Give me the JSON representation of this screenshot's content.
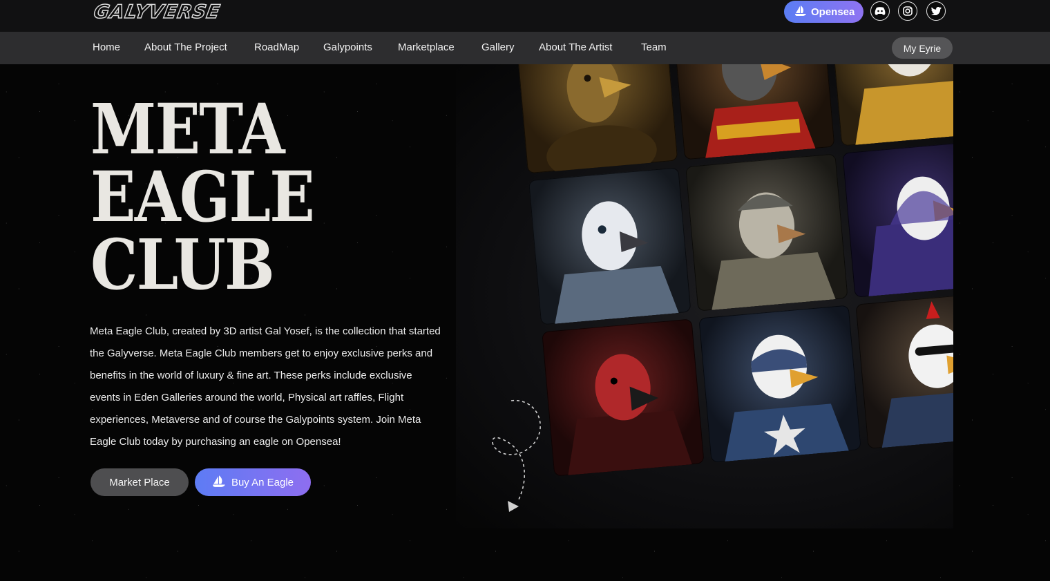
{
  "header": {
    "logo_text": "GALYVERSE",
    "opensea_label": "Opensea",
    "social_icons": [
      "discord-icon",
      "instagram-icon",
      "twitter-icon"
    ]
  },
  "nav": {
    "items": [
      "Home",
      "About The Project",
      "RoadMap",
      "Galypoints",
      "Marketplace",
      "Gallery",
      "About The Artist",
      "Team"
    ],
    "eyrie_label": "My Eyrie"
  },
  "hero": {
    "title_lines": [
      "META",
      "EAGLE",
      "CLUB"
    ],
    "description": "Meta Eagle Club, created by 3D artist Gal Yosef, is the collection that started the Galyverse. Meta Eagle Club members get to enjoy exclusive perks and benefits in the world of luxury & fine art. These perks include exclusive events in Eden Galleries around the world, Physical art raffles, Flight experiences, Metaverse and of course the Galypoints system. Join Meta Eagle Club today by purchasing an eagle on Opensea!",
    "market_button": "Market Place",
    "buy_button": "Buy An Eagle"
  },
  "colors": {
    "accent_gradient_start": "#5a7df3",
    "accent_gradient_end": "#8f73f2",
    "nav_background": "#2d2d2f",
    "topbar_background": "#111112"
  }
}
